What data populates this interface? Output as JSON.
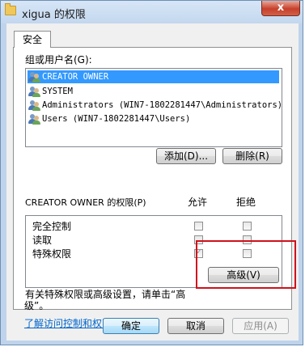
{
  "window": {
    "title": "xigua 的权限",
    "close_glyph": "x"
  },
  "tabs": [
    {
      "label": "安全",
      "selected": true
    }
  ],
  "users": {
    "group_label": "组或用户名(G):",
    "items": [
      {
        "name": "CREATOR OWNER",
        "selected": true
      },
      {
        "name": "SYSTEM",
        "selected": false
      },
      {
        "name": "Administrators (WIN7-1802281447\\Administrators)",
        "selected": false
      },
      {
        "name": "Users (WIN7-1802281447\\Users)",
        "selected": false
      }
    ],
    "add_label": "添加(D)...",
    "remove_label": "删除(R)"
  },
  "permissions": {
    "header": "CREATOR OWNER 的权限(P)",
    "allow_header": "允许",
    "deny_header": "拒绝",
    "rows": [
      {
        "name": "完全控制",
        "allow": false,
        "deny": false
      },
      {
        "name": "读取",
        "allow": false,
        "deny": false
      },
      {
        "name": "特殊权限",
        "allow": true,
        "deny": false
      }
    ]
  },
  "advanced": {
    "note": "有关特殊权限或高级设置，请单击“高级”。",
    "note_line1": "有关特殊权限或高级设置，请单击“高",
    "note_line2": "级”。",
    "button_label": "高级(V)"
  },
  "link": {
    "text": "了解访问控制和权限"
  },
  "footer": {
    "ok": "确定",
    "cancel": "取消",
    "apply": "应用(A)"
  },
  "colors": {
    "selection": "#3399ff",
    "highlight_border": "#d0111b",
    "link": "#0066cc"
  }
}
